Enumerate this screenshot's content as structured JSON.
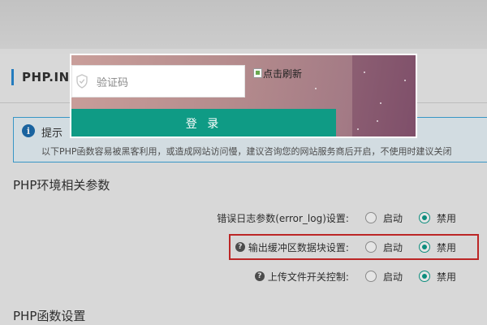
{
  "page": {
    "title": "PHP.INI",
    "tip": {
      "title": "提示",
      "text": "以下PHP函数容易被黑客利用，或造成网站访问慢，建议咨询您的网站服务商后开启，不使用时建议关闭"
    },
    "section_env": "PHP环境相关参数",
    "section_func": "PHP函数设置",
    "settings": [
      {
        "label": "错误日志参数(error_log)设置:",
        "has_help": false,
        "options": [
          "启动",
          "禁用"
        ],
        "selected": "禁用"
      },
      {
        "label": "输出缓冲区数据块设置:",
        "has_help": true,
        "options": [
          "启动",
          "禁用"
        ],
        "selected": "禁用"
      },
      {
        "label": "上传文件开关控制:",
        "has_help": true,
        "options": [
          "启动",
          "禁用"
        ],
        "selected": "禁用"
      }
    ],
    "help_glyph": "?"
  },
  "modal": {
    "captcha_placeholder": "验证码",
    "captcha_image_alt": "点击刷新",
    "login_label": "登 录"
  },
  "colors": {
    "accent": "#0f9b85",
    "highlight": "#d22b2b",
    "tip_border": "#3fa7dc",
    "title_bar": "#2a8bd4"
  },
  "icons": {
    "tip": "info-icon",
    "help": "question-icon",
    "captcha": "shield-icon",
    "image": "broken-image-icon"
  }
}
